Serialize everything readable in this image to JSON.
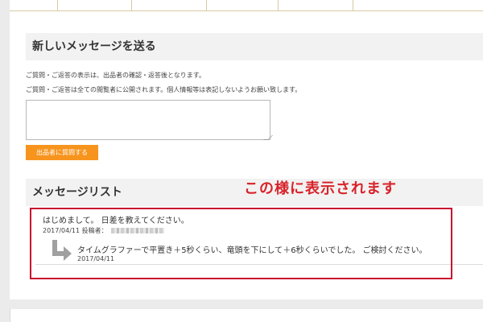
{
  "send_section": {
    "title": "新しいメッセージを送る",
    "note_1": "ご質問・ご返答の表示は、出品者の確認・返答後となります。",
    "note_2": "ご質問・ご返答は全ての閲覧者に公開されます。個人情報等は表記しないようお願い致します。",
    "message_value": "",
    "ask_button_label": "出品者に質問する"
  },
  "annotation": "この様に表示されます",
  "list_section": {
    "title": "メッセージリスト",
    "message": {
      "text": "はじめまして。 日差を教えてください。",
      "date": "2017/04/11",
      "poster_label": "投稿者："
    },
    "reply": {
      "text": "タイムグラファーで平置き＋5秒くらい、竜頭を下にして＋6秒くらいでした。 ご検討ください。",
      "date": "2017/04/11"
    }
  },
  "colors": {
    "accent_button": "#f7941d",
    "annotation_red": "#d8232a",
    "frame_red": "#c8102e",
    "arrow_gray": "#a0a0a0"
  },
  "icons": {
    "reply": "reply-arrow-icon"
  }
}
